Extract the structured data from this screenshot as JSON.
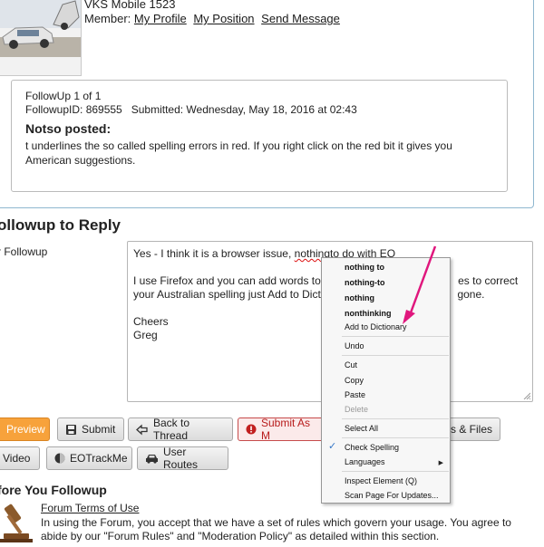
{
  "header": {
    "username": "VKS Mobile 1523",
    "member_label": "Member:",
    "links": [
      "My Profile",
      "My Position",
      "Send Message"
    ]
  },
  "followup": {
    "count_line": "FollowUp 1 of 1",
    "id_line": "FollowupID: 869555   Submitted: Wednesday, May 18, 2016 at 02:43",
    "author_line": "Notso posted:",
    "body_line1": "t underlines the so called spelling errors in red. If you right click on the red bit it gives you",
    "body_line2": "American suggestions."
  },
  "reply": {
    "heading": "ollowup to Reply",
    "label": "r Followup",
    "text_line1_a": "Yes - I think it is a browser issue, ",
    "text_line1_misspelled": "nothingto",
    "text_line1_b": " do with EO",
    "text_line2_a": "I use Firefox and you can add words to ",
    "text_line2_b": "es to correct",
    "text_line3_a": "your Australian spelling just Add to Dicti",
    "text_line3_b": "gone.",
    "text_line4": "Cheers",
    "text_line5": "Greg"
  },
  "buttons": {
    "preview": "Preview",
    "submit": "Submit",
    "back_to_thread": "Back to Thread",
    "submit_as": "Submit As M",
    "files": "es & Files",
    "video": "Video",
    "eotrackme": "EOTrackMe",
    "user_routes": "User Routes"
  },
  "before": {
    "heading": "fore You Followup",
    "terms_link": "Forum Terms of Use",
    "terms_line1": "In using the Forum, you accept that we have a set of rules which govern your usage. You agree to",
    "terms_line2": "abide by our \"Forum Rules\" and \"Moderation Policy\" as detailed within this section."
  },
  "context_menu": {
    "suggestions": [
      "nothing to",
      "nothing-to",
      "nothing",
      "nonthinking"
    ],
    "add_to_dictionary": "Add to Dictionary",
    "undo": "Undo",
    "cut": "Cut",
    "copy": "Copy",
    "paste": "Paste",
    "delete": "Delete",
    "select_all": "Select All",
    "check_spelling": "Check Spelling",
    "check_spelling_checked": true,
    "languages": "Languages",
    "inspect_element": "Inspect Element (Q)",
    "scan_page": "Scan Page For Updates..."
  },
  "colors": {
    "preview_button": "#f7a23b",
    "submit_as_border": "#c64b4b",
    "annotation_arrow": "#e0177d",
    "card_border": "#8fb7cf"
  },
  "icons": [
    "save-icon",
    "arrow-icon",
    "exclamation-icon",
    "video-icon",
    "eotrackme-icon",
    "car-icon",
    "gavel-icon",
    "checkmark-icon",
    "submenu-arrow-icon"
  ]
}
